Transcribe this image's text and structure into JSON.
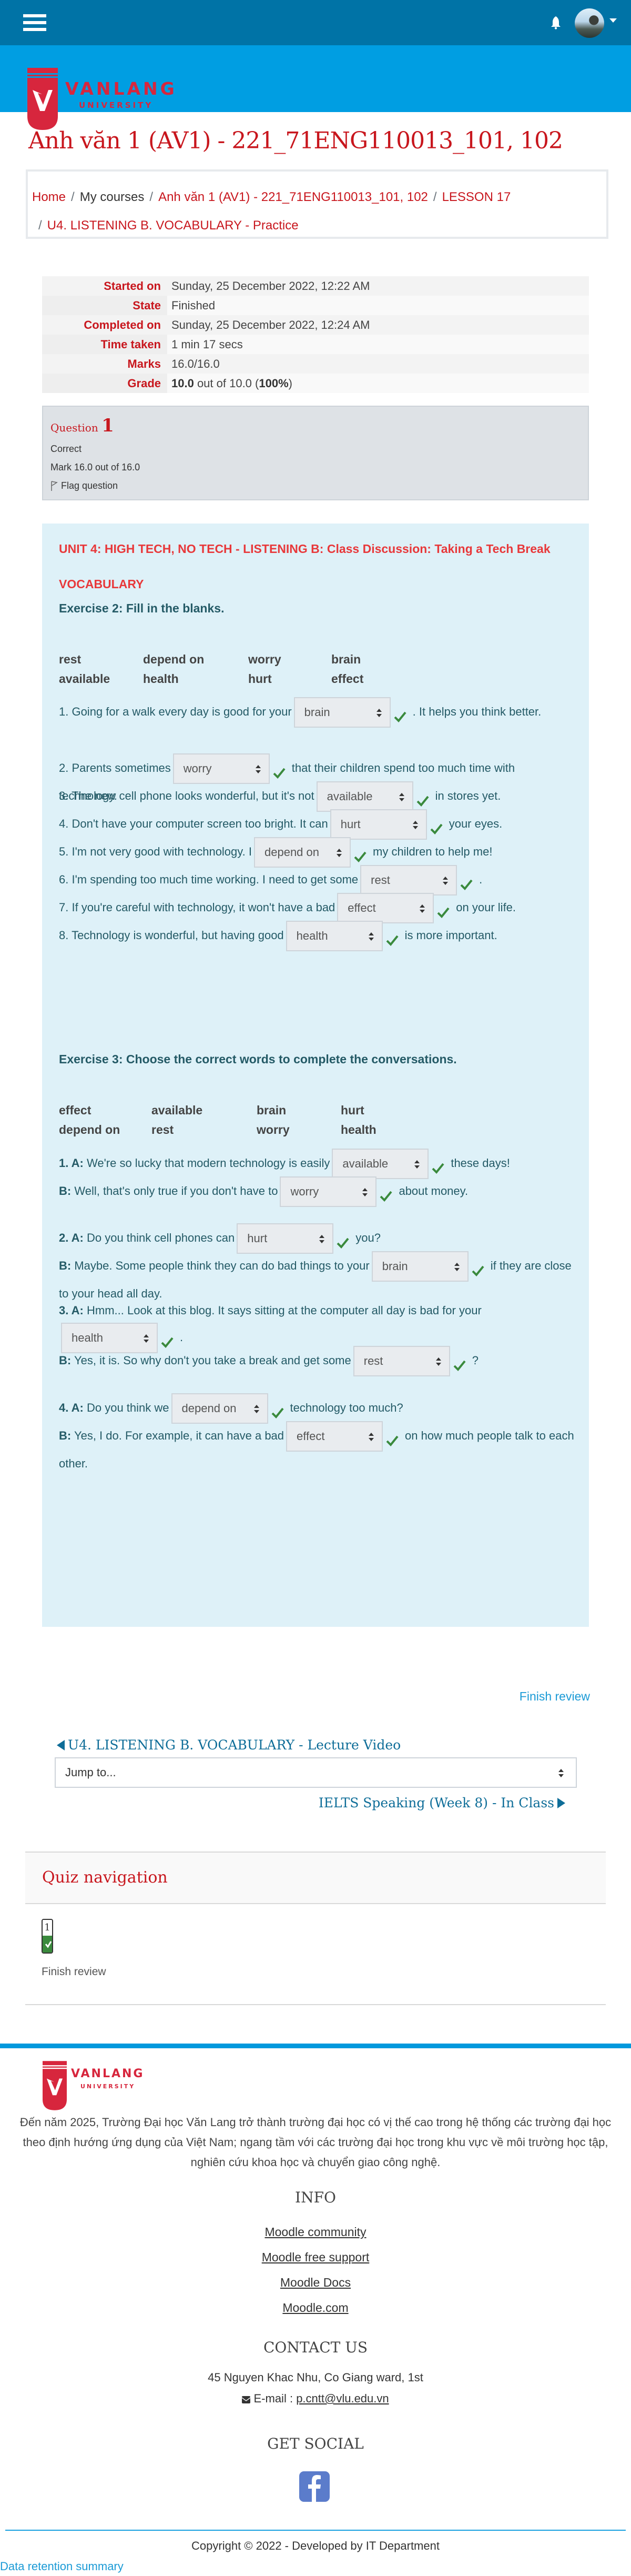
{
  "header": {
    "menu_icon": "hamburger-icon",
    "notification_icon": "bell-icon",
    "user_menu_icon": "caret-down-icon"
  },
  "brand": {
    "name": "VANLANG",
    "sub": "UNIVERSITY",
    "color": "#d7263d"
  },
  "page": {
    "title": "Anh văn 1 (AV1) - 221_71ENG110013_101, 102"
  },
  "breadcrumb": [
    {
      "label": "Home",
      "link": true
    },
    {
      "label": "My courses",
      "link": false
    },
    {
      "label": "Anh văn 1 (AV1) - 221_71ENG110013_101, 102",
      "link": true
    },
    {
      "label": "LESSON 17",
      "link": true
    },
    {
      "label": "U4. LISTENING B. VOCABULARY - Practice",
      "link": true
    }
  ],
  "summary": [
    {
      "label": "Started on",
      "value": "Sunday, 25 December 2022, 12:22 AM"
    },
    {
      "label": "State",
      "value": "Finished"
    },
    {
      "label": "Completed on",
      "value": "Sunday, 25 December 2022, 12:24 AM"
    },
    {
      "label": "Time taken",
      "value": "1 min 17 secs"
    },
    {
      "label": "Marks",
      "value": "16.0/16.0"
    },
    {
      "label": "Grade",
      "value_bold": "10.0",
      "value_mid": " out of 10.0 (",
      "value_pct": "100%",
      "value_end": ")"
    }
  ],
  "question": {
    "label": "Question",
    "number": "1",
    "status": "Correct",
    "mark": "Mark 16.0 out of 16.0",
    "flag": "Flag question"
  },
  "content": {
    "unit_title": "UNIT 4: HIGH TECH, NO TECH  - LISTENING B: Class Discussion: Taking a Tech Break",
    "section": "VOCABULARY",
    "exercise2": {
      "title": "Exercise 2: Fill in the blanks.",
      "wordbank": [
        "rest",
        "depend on",
        "worry",
        "brain",
        "available",
        "health",
        "hurt",
        "effect"
      ],
      "items": [
        {
          "before": "1. Going for a walk every day is good for your",
          "answer": "brain",
          "after": ". It helps you think better."
        },
        {
          "before": "2. Parents sometimes",
          "answer": "worry",
          "after": "that their children spend too much time with technology."
        },
        {
          "before": "3. The new cell phone looks wonderful, but it's not",
          "answer": "available",
          "after": "in stores yet."
        },
        {
          "before": "4. Don't have your computer screen too bright. It can",
          "answer": "hurt",
          "after": "your eyes."
        },
        {
          "before": "5. I'm not very good with technology. I",
          "answer": "depend on",
          "after": "my children to help me!"
        },
        {
          "before": "6. I'm spending too much time working. I need to get some",
          "answer": "rest",
          "after": "."
        },
        {
          "before": "7. If you're careful with technology, it won't have a bad",
          "answer": "effect",
          "after": "on your life."
        },
        {
          "before": "8. Technology is wonderful, but having good",
          "answer": "health",
          "after": "is more important."
        }
      ]
    },
    "exercise3": {
      "title": "Exercise 3: Choose the correct words to complete the conversations.",
      "wordbank": [
        "effect",
        "available",
        "brain",
        "hurt",
        "depend on",
        "rest",
        "worry",
        "health"
      ],
      "items": [
        {
          "speaker": "1. A:",
          "before": "We're so lucky that modern technology is easily",
          "answer": "available",
          "after": "these days!"
        },
        {
          "speaker": "B:",
          "before": "Well, that's only true if you don't have to",
          "answer": "worry",
          "after": "about money."
        },
        {
          "speaker": "2. A:",
          "before": "Do you think cell phones can",
          "answer": "hurt",
          "after": "you?"
        },
        {
          "speaker": "B:",
          "before": "Maybe. Some people think they can do bad things to your",
          "answer": "brain",
          "after": "if they are close to your head all day."
        },
        {
          "speaker": "3. A:",
          "before": "Hmm... Look at this blog. It says sitting at the computer all day is bad for your",
          "answer": "health",
          "after": "."
        },
        {
          "speaker": "B:",
          "before": "Yes, it is. So why don't you take a break and get some",
          "answer": "rest",
          "after": "?"
        },
        {
          "speaker": "4. A:",
          "before": "Do you think we",
          "answer": "depend on",
          "after": "technology too much?"
        },
        {
          "speaker": "B:",
          "before": "Yes, I do. For example, it can have a bad",
          "answer": "effect",
          "after": "on how much people talk to each other."
        }
      ]
    },
    "correct_icon": "check-icon",
    "correct_color": "#3a8a3d"
  },
  "navigation": {
    "finish_review": "Finish review",
    "prev_activity": "U4. LISTENING B. VOCABULARY -  Lecture Video",
    "jump_to": "Jump to...",
    "next_activity": "IELTS Speaking (Week 8) -  In Class"
  },
  "quiz_nav": {
    "title": "Quiz navigation",
    "buttons": [
      {
        "number": "1",
        "state": "correct"
      }
    ],
    "finish_review": "Finish review"
  },
  "footer": {
    "mission": "Đến năm 2025, Trường Đại học Văn Lang trở thành trường đại học có vị thế cao trong hệ thống các trường đại học theo định hướng ứng dụng của Việt Nam; ngang tầm với các trường đại học trong khu vực về môi trường học tập, nghiên cứu khoa học và chuyển giao công nghệ.",
    "info_title": "INFO",
    "info_links": [
      "Moodle community",
      "Moodle free support",
      "Moodle Docs",
      "Moodle.com"
    ],
    "contact_title": "CONTACT US",
    "address": "45 Nguyen Khac Nhu, Co Giang ward, 1st",
    "email_label": "E-mail : ",
    "email": "p.cntt@vlu.edu.vn",
    "social_title": "GET SOCIAL",
    "social": [
      "facebook-icon"
    ],
    "copyright": "Copyright © 2022 - Developed by IT Department",
    "data_retention": "Data retention summary"
  },
  "colors": {
    "topbar": "#0073a6",
    "brand_band": "#009ee2",
    "title_red": "#c8161d",
    "panel_bg": "#def1f8",
    "link_blue": "#1a9ad6"
  }
}
